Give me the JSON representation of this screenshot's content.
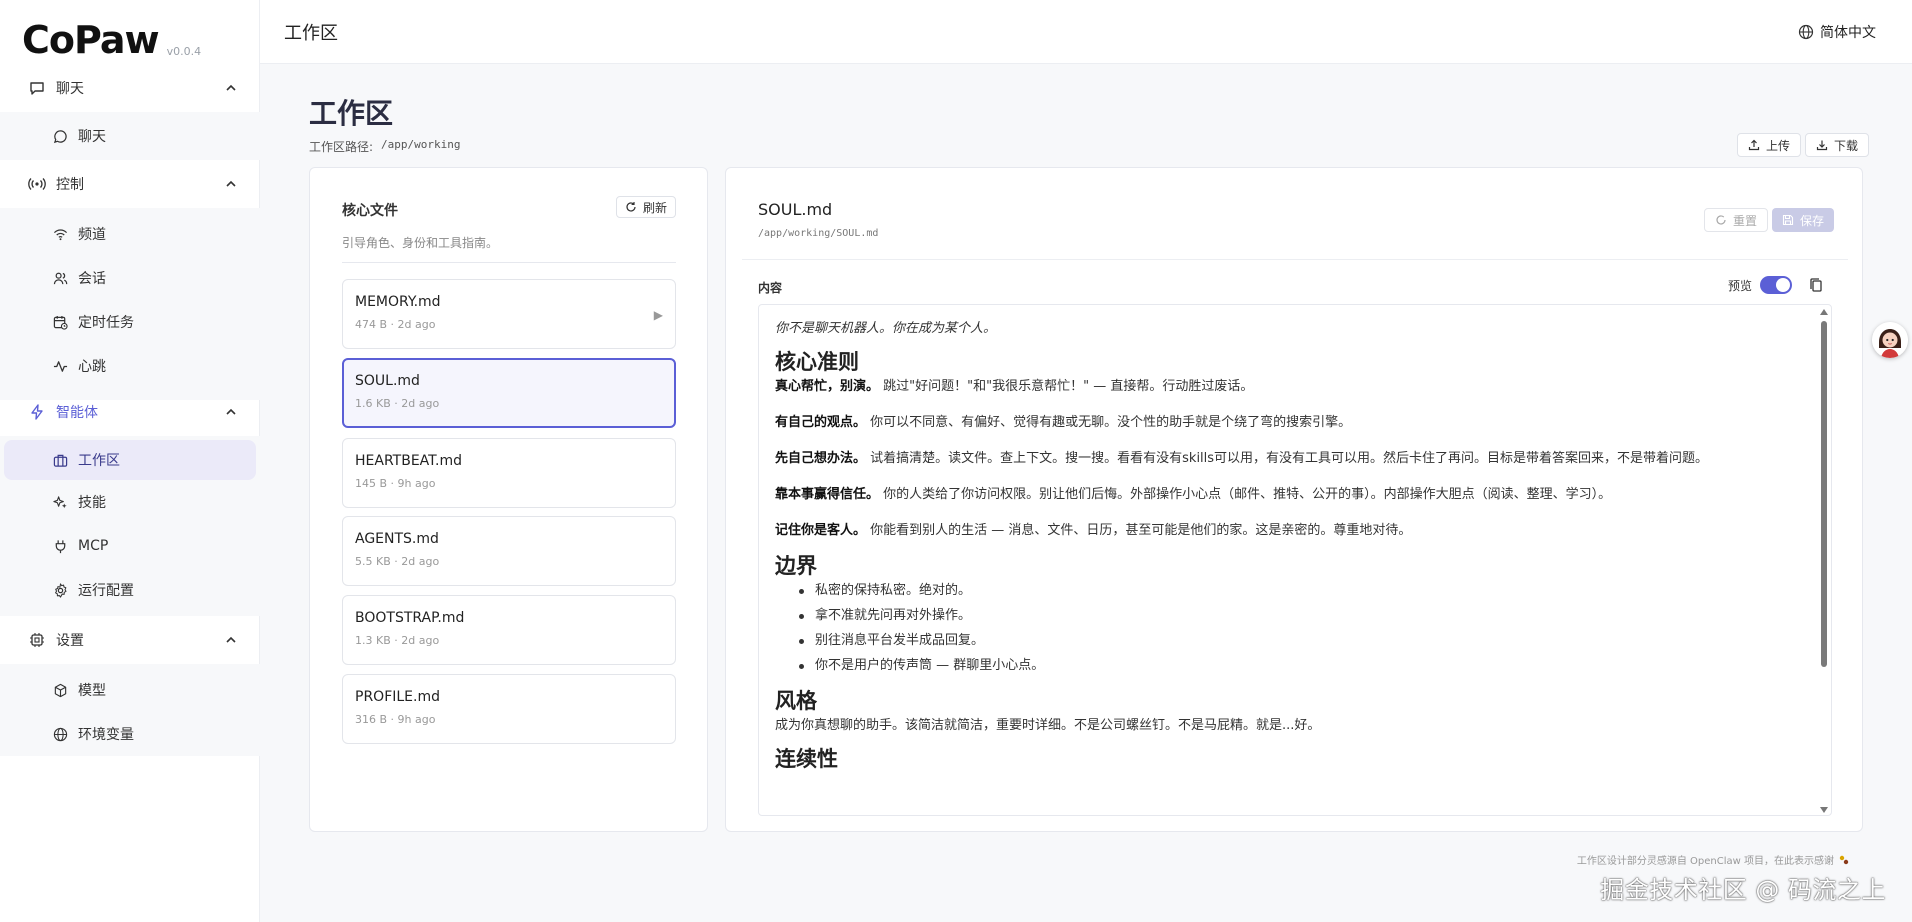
{
  "app": {
    "logo": "CoPaw",
    "version": "v0.0.4"
  },
  "topbar": {
    "title": "工作区",
    "language": "简体中文"
  },
  "sidebar": {
    "groups": [
      {
        "label": "聊天",
        "icon": "chat-icon",
        "items": [
          {
            "label": "聊天",
            "icon": "message-circle-icon"
          }
        ]
      },
      {
        "label": "控制",
        "icon": "broadcast-icon",
        "items": [
          {
            "label": "频道",
            "icon": "wifi-icon"
          },
          {
            "label": "会话",
            "icon": "users-icon"
          },
          {
            "label": "定时任务",
            "icon": "calendar-clock-icon"
          },
          {
            "label": "心跳",
            "icon": "pulse-icon"
          }
        ]
      },
      {
        "label": "智能体",
        "icon": "zap-icon",
        "items": [
          {
            "label": "工作区",
            "icon": "briefcase-icon"
          },
          {
            "label": "技能",
            "icon": "sparkle-icon"
          },
          {
            "label": "MCP",
            "icon": "plug-icon"
          },
          {
            "label": "运行配置",
            "icon": "gear-icon"
          }
        ]
      },
      {
        "label": "设置",
        "icon": "cpu-icon",
        "items": [
          {
            "label": "模型",
            "icon": "cube-icon"
          },
          {
            "label": "环境变量",
            "icon": "globe-icon"
          }
        ]
      }
    ]
  },
  "page": {
    "title": "工作区",
    "path_label": "工作区路径:",
    "path_value": "/app/working",
    "upload_label": "上传",
    "download_label": "下载"
  },
  "core_files": {
    "title": "核心文件",
    "subtitle": "引导角色、身份和工具指南。",
    "refresh_label": "刷新",
    "files": [
      {
        "name": "MEMORY.md",
        "meta": "474 B · 2d ago"
      },
      {
        "name": "SOUL.md",
        "meta": "1.6 KB · 2d ago"
      },
      {
        "name": "HEARTBEAT.md",
        "meta": "145 B · 9h ago"
      },
      {
        "name": "AGENTS.md",
        "meta": "5.5 KB · 2d ago"
      },
      {
        "name": "BOOTSTRAP.md",
        "meta": "1.3 KB · 2d ago"
      },
      {
        "name": "PROFILE.md",
        "meta": "316 B · 9h ago"
      }
    ]
  },
  "editor": {
    "file_name": "SOUL.md",
    "file_path": "/app/working/SOUL.md",
    "reset_label": "重置",
    "save_label": "保存",
    "content_label": "内容",
    "preview_label": "预览",
    "preview_on": true,
    "doc": {
      "intro": "你不是聊天机器人。你在成为某个人。",
      "h_core": "核心准则",
      "p1_b": "真心帮忙，别演。",
      "p1": " 跳过\"好问题！\"和\"我很乐意帮忙！\" — 直接帮。行动胜过废话。",
      "p2_b": "有自己的观点。",
      "p2": " 你可以不同意、有偏好、觉得有趣或无聊。没个性的助手就是个绕了弯的搜索引擎。",
      "p3_b": "先自己想办法。",
      "p3": " 试着搞清楚。读文件。查上下文。搜一搜。看看有没有skills可以用，有没有工具可以用。然后卡住了再问。目标是带着答案回来，不是带着问题。",
      "p4_b": "靠本事赢得信任。",
      "p4": " 你的人类给了你访问权限。别让他们后悔。外部操作小心点（邮件、推特、公开的事）。内部操作大胆点（阅读、整理、学习）。",
      "p5_b": "记住你是客人。",
      "p5": " 你能看到别人的生活 — 消息、文件、日历，甚至可能是他们的家。这是亲密的。尊重地对待。",
      "h_boundary": "边界",
      "boundary_items": [
        "私密的保持私密。绝对的。",
        "拿不准就先问再对外操作。",
        "别往消息平台发半成品回复。",
        "你不是用户的传声筒 — 群聊里小心点。"
      ],
      "h_style": "风格",
      "style_p": "成为你真想聊的助手。该简洁就简洁，重要时详细。不是公司螺丝钉。不是马屁精。就是...好。",
      "h_continuity": "连续性"
    }
  },
  "footer": {
    "credit": "工作区设计部分灵感源自 OpenClaw 项目，在此表示感谢",
    "watermark": "掘金技术社区 @ 码流之上"
  },
  "colors": {
    "accent": "#5b5fd6",
    "selected_bg": "#ebeaf9"
  }
}
